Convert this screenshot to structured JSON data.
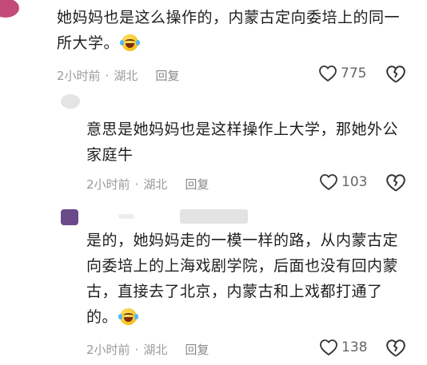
{
  "comments": [
    {
      "lines": [
        "她妈妈也是这么操作的，内蒙古定向委培上的同一",
        "所大学。"
      ],
      "time": "2小时前",
      "location": "湖北",
      "reply_label": "回复",
      "likes": "775"
    },
    {
      "lines": [
        "意思是她妈妈也是这样操作上大学，那她外公",
        "家庭牛"
      ],
      "time": "2小时前",
      "location": "湖北",
      "reply_label": "回复",
      "likes": "103"
    },
    {
      "lines": [
        "是的，她妈妈走的一模一样的路，从内蒙古定",
        "向委培上的上海戏剧学院，后面也没有回内蒙",
        "古，直接去了北京，内蒙古和上戏都打通了",
        "的。"
      ],
      "time": "2小时前",
      "location": "湖北",
      "reply_label": "回复",
      "likes": "138"
    }
  ],
  "icons": {
    "like": "heart-icon",
    "dislike": "broken-heart-icon",
    "emoji": "laughing-crying-emoji"
  },
  "colors": {
    "meta": "#9a9a9a",
    "text": "#1e1e1e",
    "avatar1": "#c44a7a",
    "avatar3": "#6a4a8a"
  }
}
